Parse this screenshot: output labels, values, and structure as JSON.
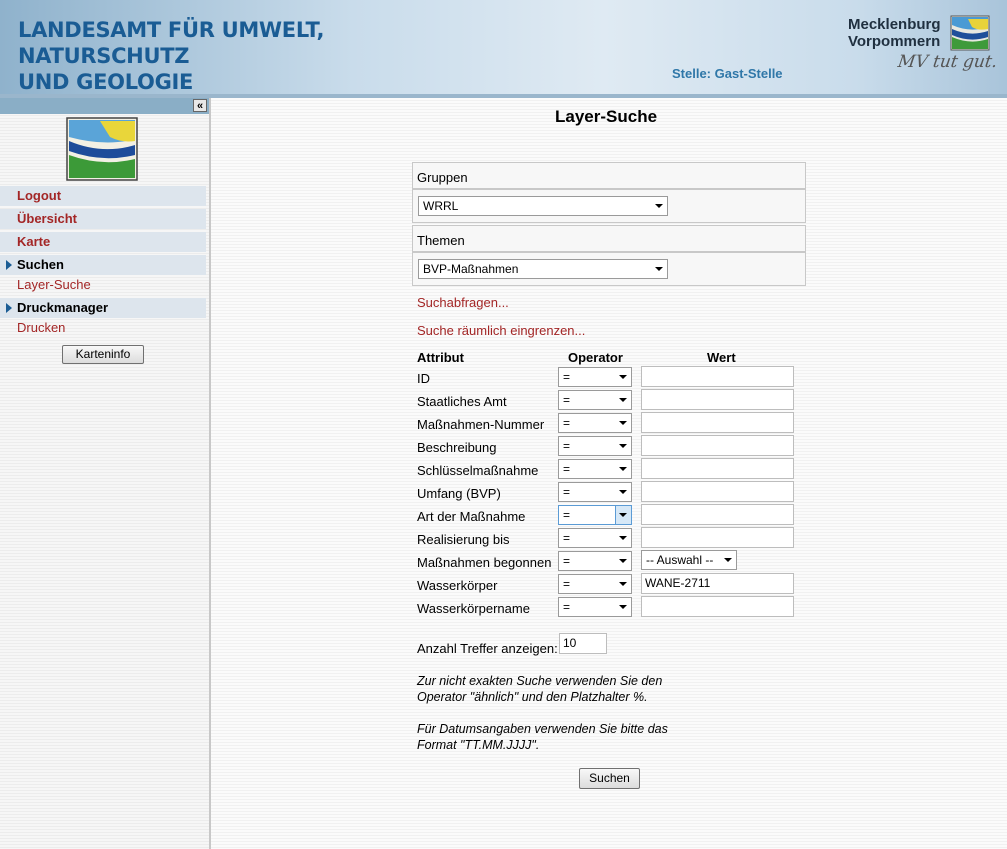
{
  "header": {
    "title_line1": "LANDESAMT FÜR UMWELT, NATURSCHUTZ",
    "title_line2": "UND GEOLOGIE",
    "stelle": "Stelle: Gast-Stelle",
    "brand_line1": "Mecklenburg",
    "brand_line2": "Vorpommern",
    "slogan": "MV tut gut."
  },
  "sidebar": {
    "collapse_label": "«",
    "menu": {
      "logout": "Logout",
      "uebersicht": "Übersicht",
      "karte": "Karte",
      "suchen": "Suchen",
      "layer_suche": "Layer-Suche",
      "druckmanager": "Druckmanager",
      "drucken": "Drucken"
    },
    "karteninfo_button": "Karteninfo"
  },
  "main": {
    "title": "Layer-Suche",
    "gruppen_label": "Gruppen",
    "gruppen_value": "WRRL",
    "themen_label": "Themen",
    "themen_value": "BVP-Maßnahmen",
    "suchabfragen_link": "Suchabfragen...",
    "raeumlich_link": "Suche räumlich eingrenzen...",
    "columns": {
      "attribut": "Attribut",
      "operator": "Operator",
      "wert": "Wert"
    },
    "rows": [
      {
        "label": "ID",
        "operator": "=",
        "value": ""
      },
      {
        "label": "Staatliches Amt",
        "operator": "=",
        "value": ""
      },
      {
        "label": "Maßnahmen-Nummer",
        "operator": "=",
        "value": ""
      },
      {
        "label": "Beschreibung",
        "operator": "=",
        "value": ""
      },
      {
        "label": "Schlüsselmaßnahme",
        "operator": "=",
        "value": ""
      },
      {
        "label": "Umfang (BVP)",
        "operator": "=",
        "value": ""
      },
      {
        "label": "Art der Maßnahme",
        "operator": "=",
        "value": ""
      },
      {
        "label": "Realisierung bis",
        "operator": "=",
        "value": ""
      },
      {
        "label": "Maßnahmen begonnen",
        "operator": "=",
        "value": "-- Auswahl --"
      },
      {
        "label": "Wasserkörper",
        "operator": "=",
        "value": "WANE-2711"
      },
      {
        "label": "Wasserkörpername",
        "operator": "=",
        "value": ""
      }
    ],
    "anzahl_label": "Anzahl Treffer anzeigen:",
    "anzahl_value": "10",
    "hint1_line1": "Zur nicht exakten Suche verwenden Sie den",
    "hint1_line2": "Operator \"ähnlich\" und den Platzhalter %.",
    "hint2_line1": "Für Datumsangaben verwenden Sie bitte das",
    "hint2_line2": "Format \"TT.MM.JJJJ\".",
    "search_button": "Suchen"
  },
  "colors": {
    "header_title": "#1a5c94",
    "link_red": "#a32626",
    "menu_bg": "#dde5ed",
    "sidebar_bar": "#8aaec6"
  }
}
